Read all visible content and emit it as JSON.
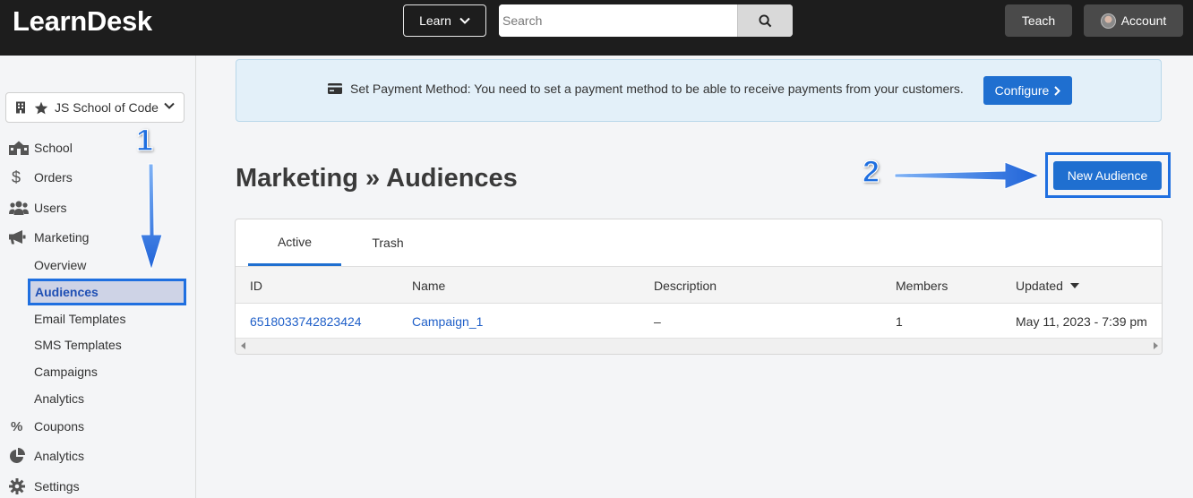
{
  "app": {
    "logo": "LearnDesk"
  },
  "topbar": {
    "learn_label": "Learn",
    "search_placeholder": "Search",
    "teach_label": "Teach",
    "account_label": "Account"
  },
  "sidebar": {
    "school_name": "JS School of Code",
    "items": [
      {
        "label": "School",
        "icon": "school-building-icon"
      },
      {
        "label": "Orders",
        "icon": "dollar-icon"
      },
      {
        "label": "Users",
        "icon": "users-icon"
      },
      {
        "label": "Marketing",
        "icon": "megaphone-icon"
      }
    ],
    "marketing_sub": [
      "Overview",
      "Audiences",
      "Email Templates",
      "SMS Templates",
      "Campaigns",
      "Analytics"
    ],
    "items_after": [
      {
        "label": "Coupons",
        "icon": "percent-icon"
      },
      {
        "label": "Analytics",
        "icon": "pie-chart-icon"
      },
      {
        "label": "Settings",
        "icon": "gear-icon"
      }
    ]
  },
  "banner": {
    "text": "Set Payment Method: You need to set a payment method to be able to receive payments from your customers.",
    "button_label": "Configure"
  },
  "page": {
    "title": "Marketing » Audiences",
    "new_button_label": "New Audience"
  },
  "tabs": [
    "Active",
    "Trash"
  ],
  "table": {
    "columns": [
      "ID",
      "Name",
      "Description",
      "Members",
      "Updated"
    ],
    "rows": [
      {
        "id": "6518033742823424",
        "name": "Campaign_1",
        "description": "–",
        "members": "1",
        "updated": "May 11, 2023 - 7:39 pm"
      }
    ]
  },
  "annotations": {
    "step1": "1",
    "step2": "2"
  },
  "colors": {
    "accent": "#1f6fd0",
    "topbar": "#1d1d1d",
    "banner_bg": "#e3f0f9"
  }
}
